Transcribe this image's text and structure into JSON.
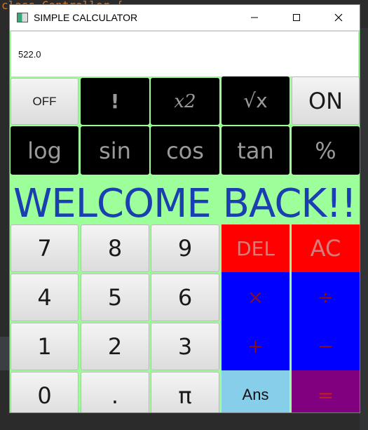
{
  "window": {
    "title": "SIMPLE CALCULATOR",
    "controls": {
      "minimize": "minimize-icon",
      "maximize": "maximize-icon",
      "close": "close-icon"
    }
  },
  "display": {
    "value": "522.0"
  },
  "keys": {
    "off": "OFF",
    "factorial": "!",
    "square": "x2",
    "sqrt": "√x",
    "on": "ON",
    "log": "log",
    "sin": "sin",
    "cos": "cos",
    "tan": "tan",
    "percent": "%",
    "seven": "7",
    "eight": "8",
    "nine": "9",
    "del": "DEL",
    "ac": "AC",
    "four": "4",
    "five": "5",
    "six": "6",
    "multiply": "×",
    "divide": "÷",
    "one": "1",
    "two": "2",
    "three": "3",
    "plus": "+",
    "minus": "−",
    "zero": "0",
    "dot": ".",
    "pi": "π",
    "ans": "Ans",
    "equals": "="
  },
  "banner": {
    "text": "WELCOME BACK!!"
  },
  "background_ide": {
    "line1": "class Controller {"
  },
  "colors": {
    "window_bg": "#9dff9a",
    "banner_text": "#1a3fb0",
    "del_ac": "#ff0000",
    "operators": "#0000ff",
    "ans": "#87ceeb",
    "equals": "#800080",
    "function_keys": "#000000"
  }
}
